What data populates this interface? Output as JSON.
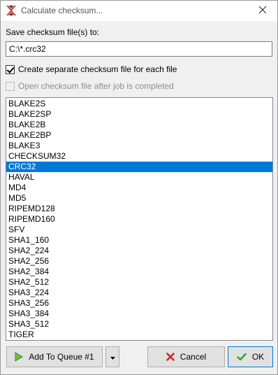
{
  "window": {
    "title": "Calculate checksum...",
    "app_icon": "double-commander-icon",
    "close_icon": "close-icon"
  },
  "save": {
    "label": "Save checksum file(s) to:",
    "path_value": "C:\\*.crc32"
  },
  "options": {
    "separate_label": "Create separate checksum file for each file",
    "separate_checked": true,
    "open_label": "Open checksum file after job is completed",
    "open_checked": false,
    "open_enabled": false
  },
  "algorithms": {
    "items": [
      "BLAKE2S",
      "BLAKE2SP",
      "BLAKE2B",
      "BLAKE2BP",
      "BLAKE3",
      "CHECKSUM32",
      "CRC32",
      "HAVAL",
      "MD4",
      "MD5",
      "RIPEMD128",
      "RIPEMD160",
      "SFV",
      "SHA1_160",
      "SHA2_224",
      "SHA2_256",
      "SHA2_384",
      "SHA2_512",
      "SHA3_224",
      "SHA3_256",
      "SHA3_384",
      "SHA3_512",
      "TIGER"
    ],
    "selected": "CRC32",
    "selection_color": "#0078d7"
  },
  "buttons": {
    "queue_label": "Add To Queue #1",
    "cancel_label": "Cancel",
    "ok_label": "OK",
    "queue_icon": "play-arrow-icon",
    "dropdown_icon": "chevron-down-icon",
    "cancel_icon": "red-x-icon",
    "ok_icon": "green-check-icon"
  }
}
